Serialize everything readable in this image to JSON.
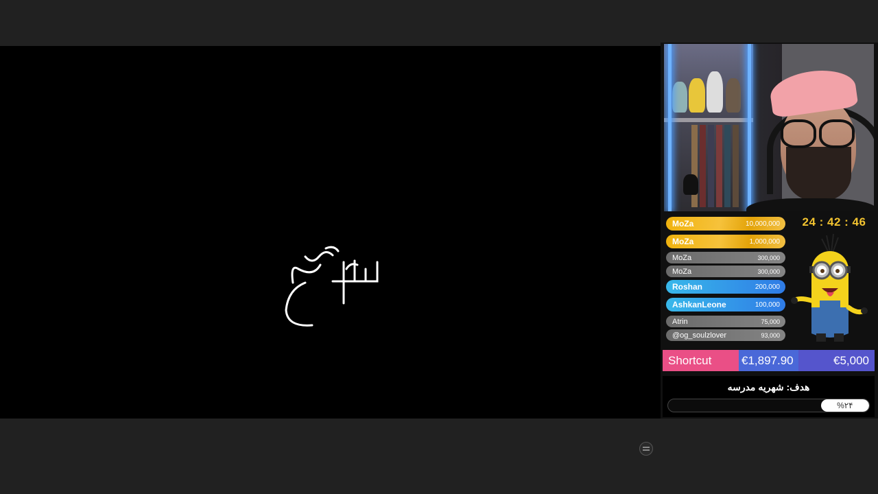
{
  "timer": "24 : 42 : 46",
  "donors": [
    {
      "name": "MoZa",
      "amount": "10,000,000",
      "tier": "gold"
    },
    {
      "name": "MoZa",
      "amount": "1,000,000",
      "tier": "gold"
    },
    {
      "name": "MoZa",
      "amount": "300,000",
      "tier": "gray"
    },
    {
      "name": "MoZa",
      "amount": "300,000",
      "tier": "gray"
    },
    {
      "name": "Roshan",
      "amount": "200,000",
      "tier": "blue"
    },
    {
      "name": "AshkanLeone",
      "amount": "100,000",
      "tier": "blue"
    },
    {
      "name": "Atrin",
      "amount": "75,000",
      "tier": "gray"
    },
    {
      "name": "@og_soulzlover",
      "amount": "93,000",
      "tier": "gray"
    }
  ],
  "goal": {
    "label": "Shortcut",
    "current": "€1,897.90",
    "target": "€5,000"
  },
  "school_goal": {
    "title": "هدف: شهریه مدرسه",
    "progress_text": "%۲۴",
    "progress_fraction": 0.24
  },
  "colors": {
    "timer": "#f2c330",
    "goal_label_bg": "#ea4f86",
    "goal_bar_bg": "#4a68d8"
  }
}
